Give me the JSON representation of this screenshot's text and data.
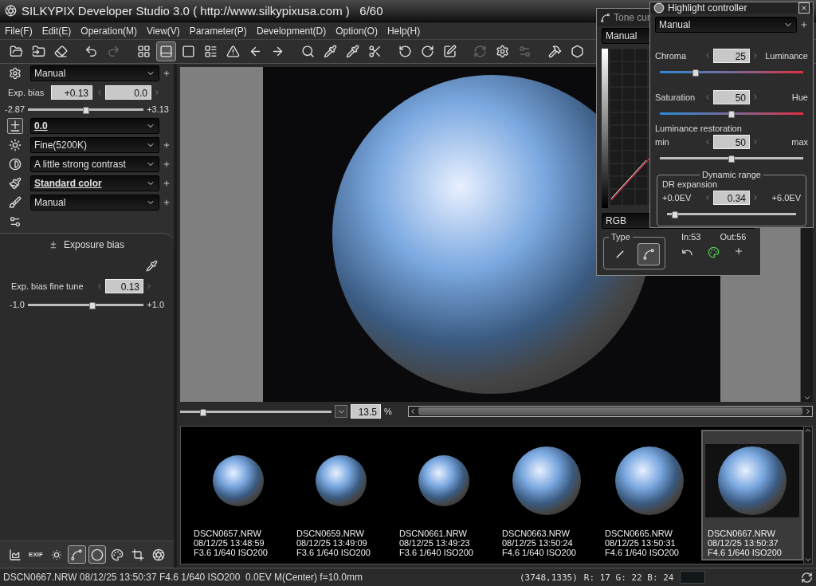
{
  "window": {
    "title": "SILKYPIX Developer Studio 3.0 ( http://www.silkypixusa.com )   6/60"
  },
  "menu": [
    "File(F)",
    "Edit(E)",
    "Operation(M)",
    "View(V)",
    "Parameter(P)",
    "Development(D)",
    "Option(O)",
    "Help(H)"
  ],
  "toolbar": [
    {
      "kind": "open",
      "selected": false,
      "disabled": false
    },
    {
      "kind": "open-recent",
      "selected": false,
      "disabled": false
    },
    {
      "kind": "eraser",
      "selected": false,
      "disabled": false
    },
    {
      "kind": "undo",
      "selected": false,
      "disabled": false
    },
    {
      "kind": "redo",
      "selected": false,
      "disabled": true
    },
    {
      "kind": "grid",
      "selected": false,
      "disabled": false
    },
    {
      "kind": "filmstrip",
      "selected": true,
      "disabled": false
    },
    {
      "kind": "single",
      "selected": false,
      "disabled": false
    },
    {
      "kind": "checklist",
      "selected": false,
      "disabled": false
    },
    {
      "kind": "warning",
      "selected": false,
      "disabled": false
    },
    {
      "kind": "prev",
      "selected": false,
      "disabled": false
    },
    {
      "kind": "next",
      "selected": false,
      "disabled": false
    },
    {
      "kind": "zoom",
      "selected": false,
      "disabled": false
    },
    {
      "kind": "picker",
      "selected": false,
      "disabled": false
    },
    {
      "kind": "picker-gray",
      "selected": false,
      "disabled": false
    },
    {
      "kind": "scissors",
      "selected": false,
      "disabled": false
    },
    {
      "kind": "rotate-left",
      "selected": false,
      "disabled": false
    },
    {
      "kind": "rotate-right",
      "selected": false,
      "disabled": false
    },
    {
      "kind": "check",
      "selected": false,
      "disabled": false
    },
    {
      "kind": "refresh",
      "selected": false,
      "disabled": true
    },
    {
      "kind": "gear-save",
      "selected": false,
      "disabled": false
    },
    {
      "kind": "gear-check",
      "selected": false,
      "disabled": true
    },
    {
      "kind": "hammer",
      "selected": false,
      "disabled": false
    },
    {
      "kind": "logo",
      "selected": false,
      "disabled": false
    }
  ],
  "left_panel": {
    "preset": "Manual",
    "exposure": {
      "label": "Exp. bias",
      "value": "+0.13",
      "step_value": "0.0",
      "min": "-2.87",
      "max": "+3.13",
      "level": 0.5
    },
    "settings": [
      {
        "kind": "exposure",
        "value": "0.0",
        "emphasized": true,
        "selected": true
      },
      {
        "kind": "white-balance",
        "value": "Fine(5200K)",
        "emphasized": false,
        "selected": false
      },
      {
        "kind": "contrast",
        "value": "A little strong contrast",
        "emphasized": false,
        "selected": false
      },
      {
        "kind": "color",
        "value": "Standard color",
        "emphasized": true,
        "selected": false
      },
      {
        "kind": "sharpness",
        "value": "Manual",
        "emphasized": false,
        "selected": false
      }
    ],
    "sub_panel": {
      "tab": "Exposure bias",
      "label": "Exp. bias fine tune",
      "value": "0.13",
      "min": "-1.0",
      "max": "+1.0",
      "level": 0.56
    },
    "bottom_tools": [
      {
        "kind": "histogram",
        "selected": false
      },
      {
        "kind": "exif",
        "label": "EXIF",
        "selected": false
      },
      {
        "kind": "brightness",
        "selected": false
      },
      {
        "kind": "tone-curve",
        "selected": true
      },
      {
        "kind": "highlight",
        "selected": true
      },
      {
        "kind": "color",
        "selected": false
      },
      {
        "kind": "crop",
        "selected": false
      },
      {
        "kind": "lens",
        "selected": false
      }
    ]
  },
  "preview": {
    "zoom": {
      "level": 0.15,
      "value": "13.5",
      "unit": "%"
    }
  },
  "thumbnails": [
    {
      "name": "DSCN0657.NRW",
      "date": "08/12/25 13:48:59",
      "exposure": "F3.6 1/640 ISO200",
      "selected": false
    },
    {
      "name": "DSCN0659.NRW",
      "date": "08/12/25 13:49:09",
      "exposure": "F3.6 1/640 ISO200",
      "selected": false
    },
    {
      "name": "DSCN0661.NRW",
      "date": "08/12/25 13:49:23",
      "exposure": "F3.6 1/640 ISO200",
      "selected": false
    },
    {
      "name": "DSCN0663.NRW",
      "date": "08/12/25 13:50:24",
      "exposure": "F4.6 1/640 ISO200",
      "selected": false
    },
    {
      "name": "DSCN0665.NRW",
      "date": "08/12/25 13:50:31",
      "exposure": "F4.6 1/640 ISO200",
      "selected": false
    },
    {
      "name": "DSCN0667.NRW",
      "date": "08/12/25 13:50:37",
      "exposure": "F4.6 1/640 ISO200",
      "selected": true
    }
  ],
  "status_bar": {
    "info": "DSCN0667.NRW 08/12/25 13:50:37 F4.6 1/640 ISO200  0.0EV M(Center) f=10.0mm",
    "coords": "(3748,1335)",
    "rgb": "R: 17 G: 22 B: 24"
  },
  "tone_curve": {
    "title": "Tone cur",
    "preset": "Manual",
    "channel": "RGB",
    "type_label": "Type",
    "types": [
      {
        "kind": "linear",
        "selected": false
      },
      {
        "kind": "curve",
        "selected": true
      }
    ],
    "input": "In:53",
    "output": "Out:56"
  },
  "highlight_controller": {
    "title": "Highlight controller",
    "preset": "Manual",
    "sliders": [
      {
        "kind": "color",
        "left": "Chroma",
        "right": "Luminance",
        "value": "25",
        "level": 0.25
      },
      {
        "kind": "color",
        "left": "Saturation",
        "right": "Hue",
        "value": "50",
        "level": 0.5
      },
      {
        "kind": "plain",
        "heading": "Luminance restoration",
        "left": "min",
        "right": "max",
        "value": "50",
        "level": 0.5
      }
    ],
    "dynamic_range": {
      "title": "Dynamic range",
      "label": "DR expansion",
      "left": "+0.0EV",
      "value": "0.34",
      "right": "+6.0EV",
      "level": 0.06
    }
  }
}
